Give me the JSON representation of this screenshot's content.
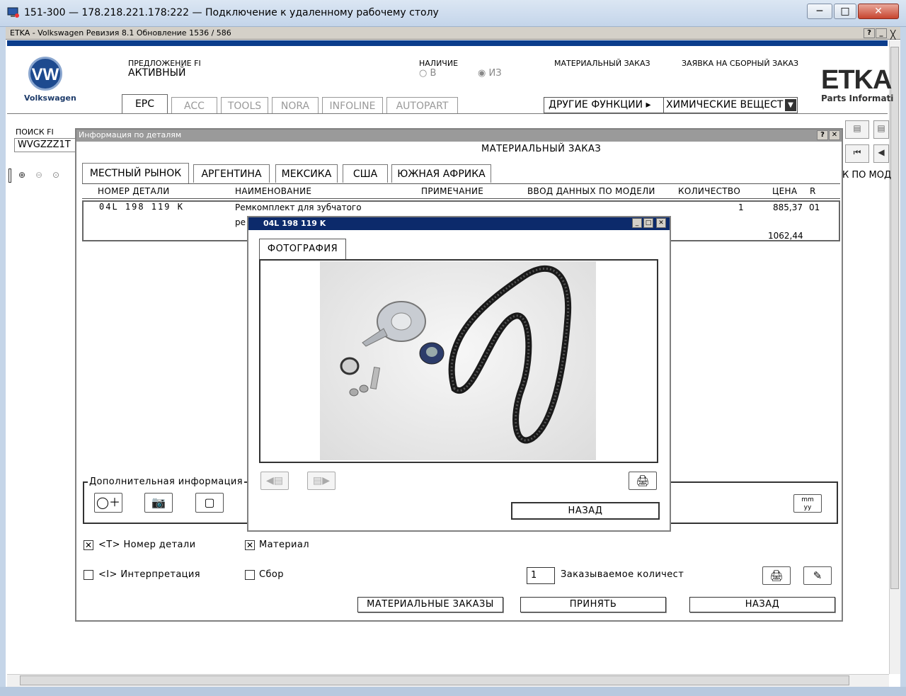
{
  "rdp": {
    "title": "151-300 — 178.218.221.178:222 — Подключение к удаленному рабочему столу"
  },
  "etka": {
    "title": "ETKA - Volkswagen Ревизия 8.1 Обновление 1536 / 586"
  },
  "header": {
    "brand": "Volkswagen",
    "offer_label": "ПРЕДЛОЖЕНИЕ FI",
    "offer_value": "АКТИВНЫЙ",
    "avail_label": "НАЛИЧИЕ",
    "avail_in": "В",
    "avail_from": "ИЗ",
    "material_order": "МАТЕРИАЛЬНЫЙ ЗАКАЗ",
    "assembly_order": "ЗАЯВКА НА СБОРНЫЙ ЗАКАЗ",
    "etka_logo": "ETKA",
    "etka_sub": "Parts Informati",
    "other_functions": "ДРУГИЕ ФУНКЦИИ ▸",
    "chem_select": "ХИМИЧЕСКИЕ ВЕЩЕСТ",
    "search_label": "ПОИСК FI",
    "search_value": "WVGZZZ1T",
    "right_nav_label": "К ПО МОД"
  },
  "app_tabs": [
    "EPC",
    "ACC",
    "TOOLS",
    "NORA",
    "INFOLINE",
    "AUTOPART"
  ],
  "dialog": {
    "title": "Информация по деталям",
    "heading": "МАТЕРИАЛЬНЫЙ ЗАКАЗ",
    "market_tabs": [
      "МЕСТНЫЙ РЫНОК",
      "АРГЕНТИНА",
      "МЕКСИКА",
      "США",
      "ЮЖНАЯ АФРИКА"
    ],
    "columns": [
      "НОМЕР ДЕТАЛИ",
      "НАИМЕНОВАНИЕ",
      "ПРИМЕЧАНИЕ",
      "ВВОД ДАННЫХ ПО МОДЕЛИ",
      "КОЛИЧЕСТВО",
      "ЦЕНА",
      "R"
    ],
    "row": {
      "part_no": "04L 198 119 K",
      "name_line1": "Ремкомплект для зубчатого",
      "name_line2": "ре",
      "qty": "1",
      "price": "885,37",
      "r": "01",
      "price2": "1062,44"
    },
    "extra_label": "Дополнительная информация",
    "mm_label": "mm",
    "yy_label": "yy",
    "chk_partno": "<T> Номер детали",
    "chk_material": "Материал",
    "chk_interp": "<I> Интерпретация",
    "chk_assembly": "Сбор",
    "qty_value": "1",
    "qty_label": "Заказываемое количест",
    "btn_orders": "МАТЕРИАЛЬНЫЕ ЗАКАЗЫ",
    "btn_accept": "ПРИНЯТЬ",
    "btn_back": "НАЗАД"
  },
  "photo": {
    "title": "04L 198 119 K",
    "tab": "ФОТОГРАФИЯ",
    "back": "НАЗАД"
  },
  "colors": {
    "etka_stripe": "#0b3d8c",
    "photo_titlebar": "#0c2a6b",
    "vw_blue": "#1d4a8f"
  }
}
